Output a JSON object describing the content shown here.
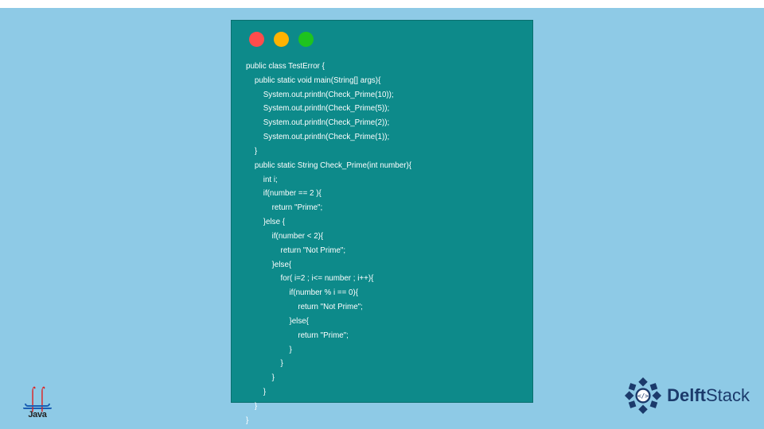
{
  "code": {
    "lines": [
      "public class TestError {",
      "    public static void main(String[] args){",
      "        System.out.println(Check_Prime(10));",
      "        System.out.println(Check_Prime(5));",
      "        System.out.println(Check_Prime(2));",
      "        System.out.println(Check_Prime(1));",
      "    }",
      "    public static String Check_Prime(int number){",
      "        int i;",
      "        if(number == 2 ){",
      "            return \"Prime\";",
      "        }else {",
      "            if(number < 2){",
      "                return \"Not Prime\";",
      "            }else{",
      "                for( i=2 ; i<= number ; i++){",
      "                    if(number % i == 0){",
      "                        return \"Not Prime\";",
      "                    }else{",
      "                        return \"Prime\";",
      "                    }",
      "                }",
      "            }",
      "        }",
      "    }",
      "}"
    ]
  },
  "logos": {
    "java_label": "Java",
    "delft_brand_bold": "Delft",
    "delft_brand_rest": "Stack"
  },
  "colors": {
    "page_bg": "#8ecae6",
    "window_bg": "#0d8a8a",
    "code_text": "#ffffff",
    "dot_red": "#ff4c4c",
    "dot_yellow": "#ffb300",
    "dot_green": "#1ec31e",
    "delft_blue": "#1b3a6b"
  }
}
